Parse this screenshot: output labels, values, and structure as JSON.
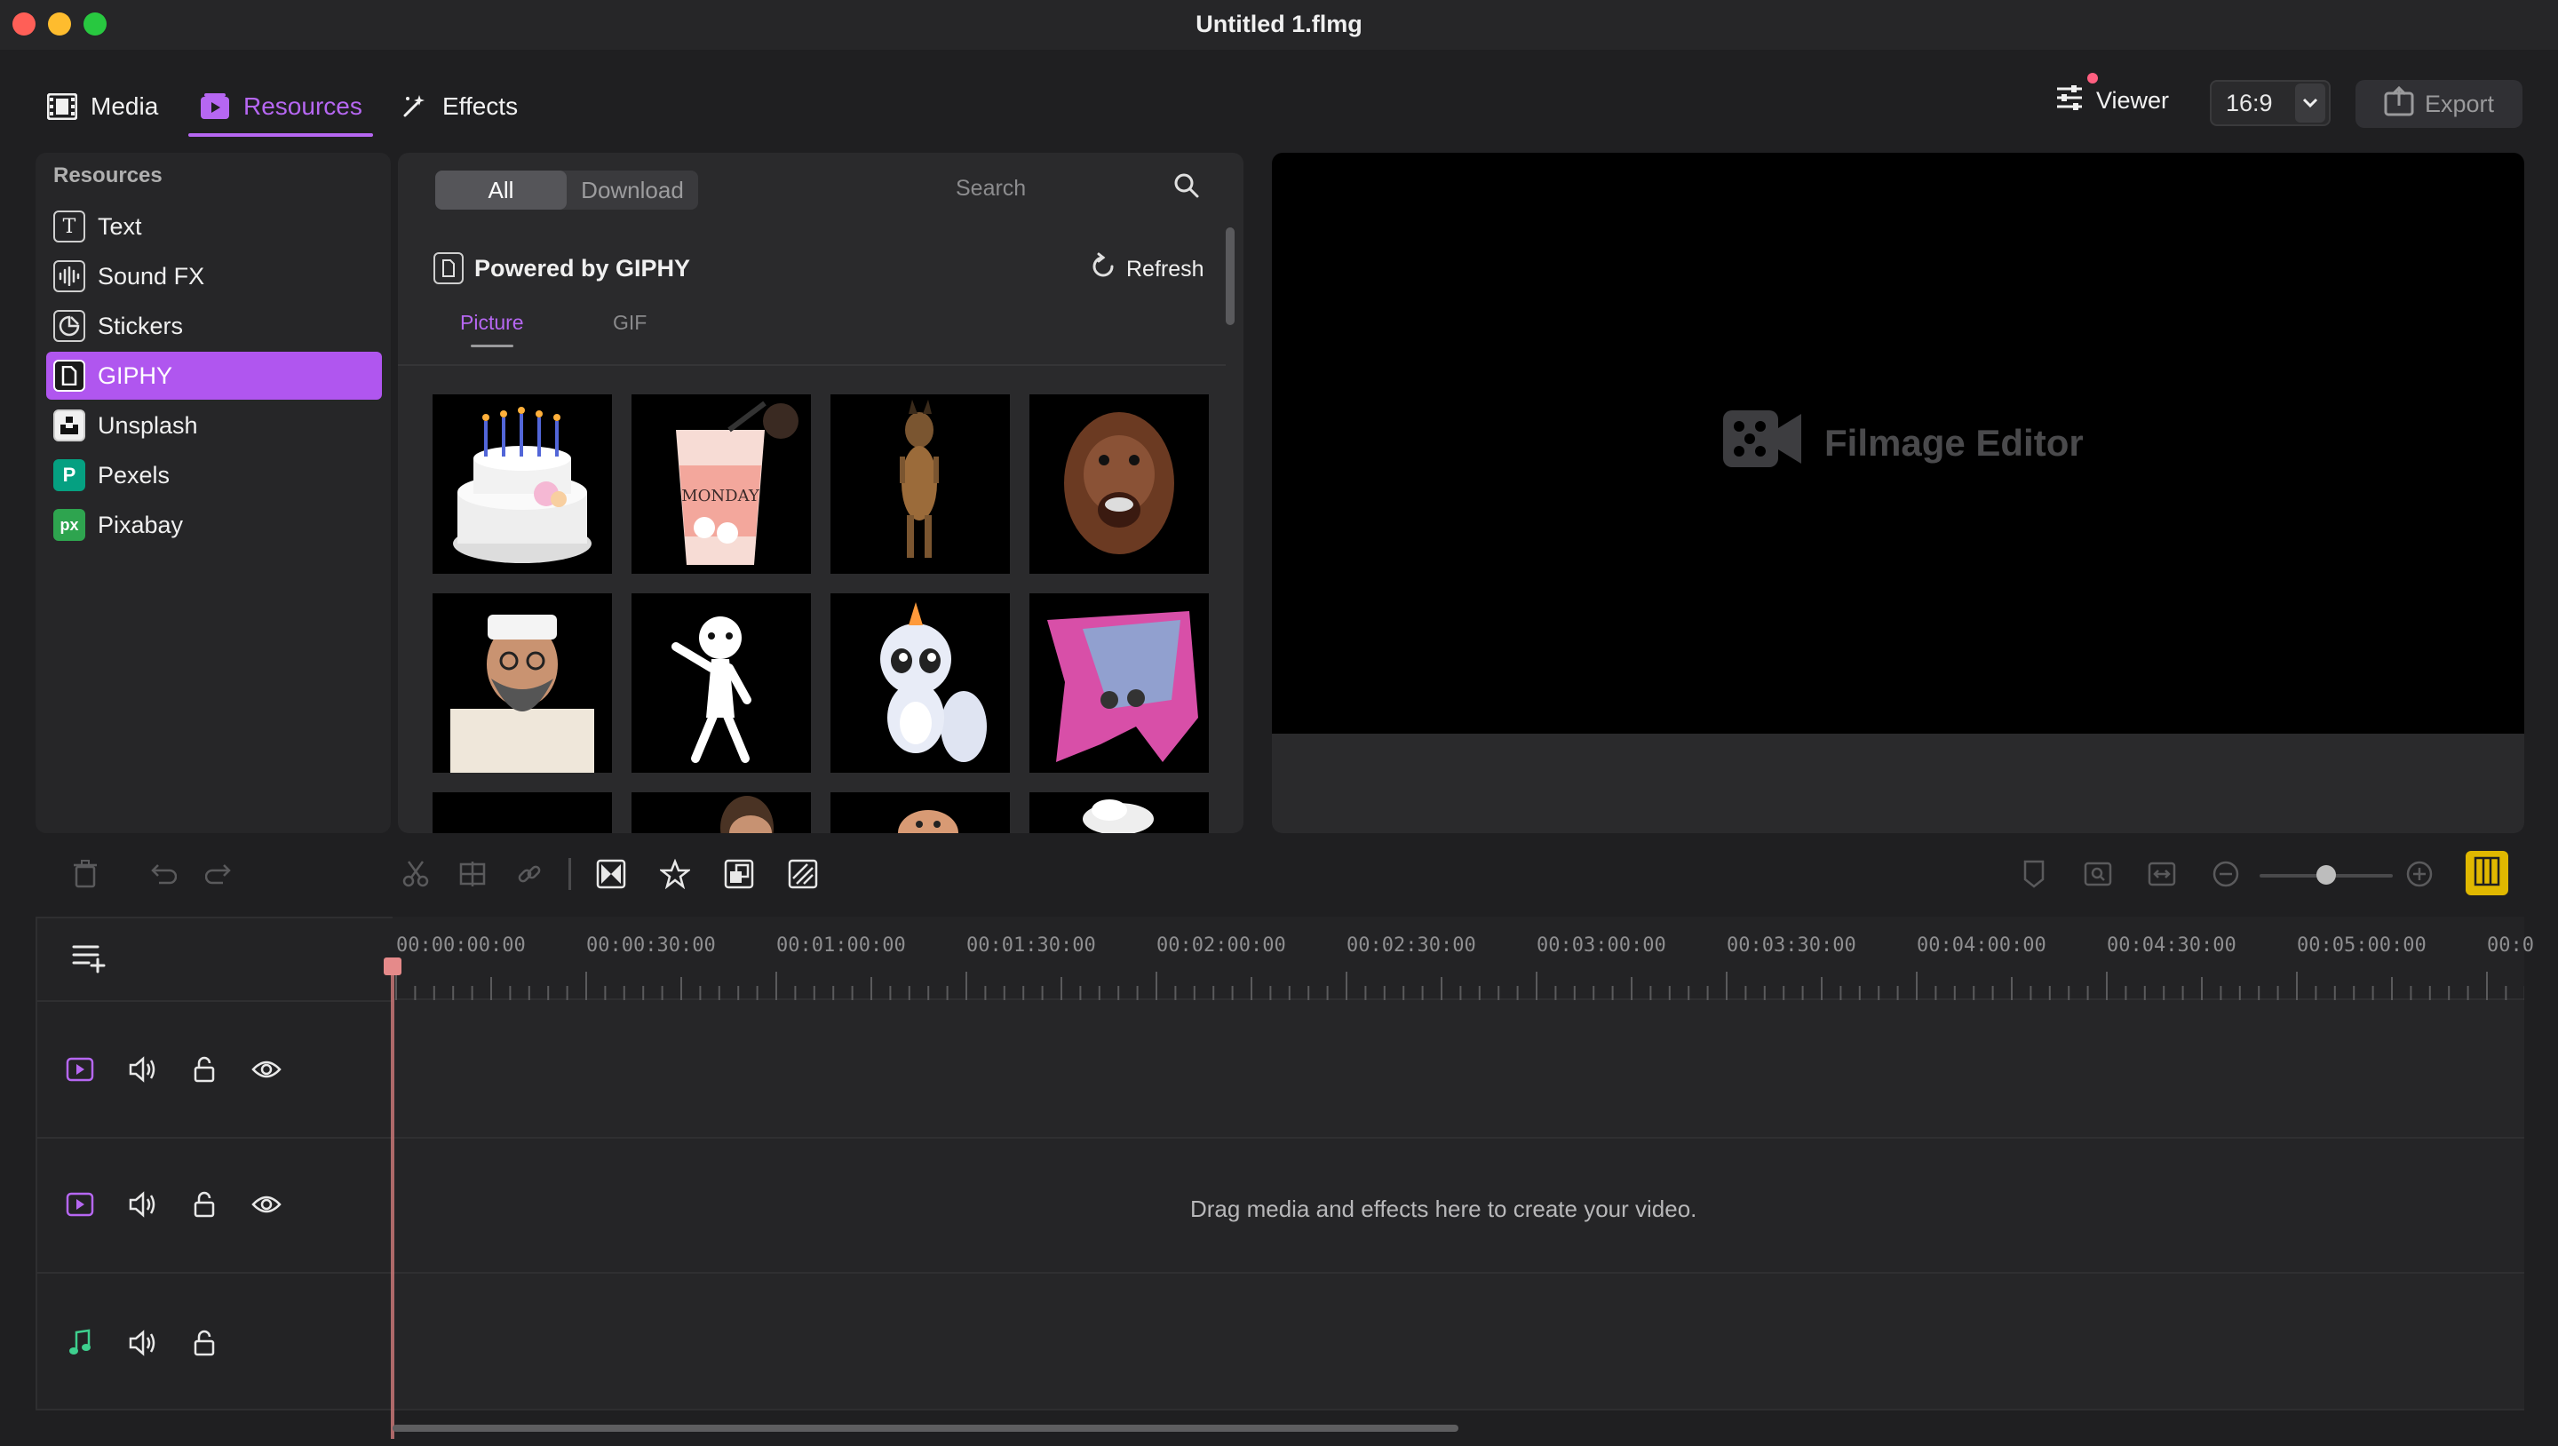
{
  "window": {
    "title": "Untitled 1.flmg",
    "traffic_colors": [
      "#ff5f57",
      "#febc2e",
      "#28c840"
    ]
  },
  "top_tabs": [
    {
      "label": "Media",
      "icon": "film-icon"
    },
    {
      "label": "Resources",
      "icon": "resources-icon"
    },
    {
      "label": "Effects",
      "icon": "magic-wand-icon"
    }
  ],
  "active_tab": "Resources",
  "right_controls": {
    "viewer_label": "Viewer",
    "aspect_ratio": "16:9",
    "export_label": "Export"
  },
  "sidebar": {
    "heading": "Resources",
    "items": [
      {
        "label": "Text",
        "icon": "text-icon"
      },
      {
        "label": "Sound FX",
        "icon": "waveform-icon"
      },
      {
        "label": "Stickers",
        "icon": "sticker-icon"
      },
      {
        "label": "GIPHY",
        "icon": "giphy-icon"
      },
      {
        "label": "Unsplash",
        "icon": "unsplash-icon"
      },
      {
        "label": "Pexels",
        "icon": "pexels-icon"
      },
      {
        "label": "Pixabay",
        "icon": "pixabay-icon"
      }
    ],
    "selected": "GIPHY"
  },
  "resource_panel": {
    "segments": [
      "All",
      "Download"
    ],
    "selected_segment": "All",
    "search_placeholder": "Search",
    "source_title": "Powered by GIPHY",
    "refresh_label": "Refresh",
    "sub_tabs": [
      "Picture",
      "GIF"
    ],
    "selected_sub_tab": "Picture"
  },
  "viewer": {
    "logo_text": "Filmage Editor"
  },
  "timeline": {
    "timecodes": [
      "00:00:00:00",
      "00:00:30:00",
      "00:01:00:00",
      "00:01:30:00",
      "00:02:00:00",
      "00:02:30:00",
      "00:03:00:00",
      "00:03:30:00",
      "00:04:00:00",
      "00:04:30:00",
      "00:05:00:00",
      "00:0"
    ],
    "drop_hint": "Drag media and effects here to create your video."
  },
  "colors": {
    "accent": "#b667f2",
    "selected_bg": "#b056ef",
    "panel": "#2a2a2c",
    "background": "#1f1f21"
  }
}
